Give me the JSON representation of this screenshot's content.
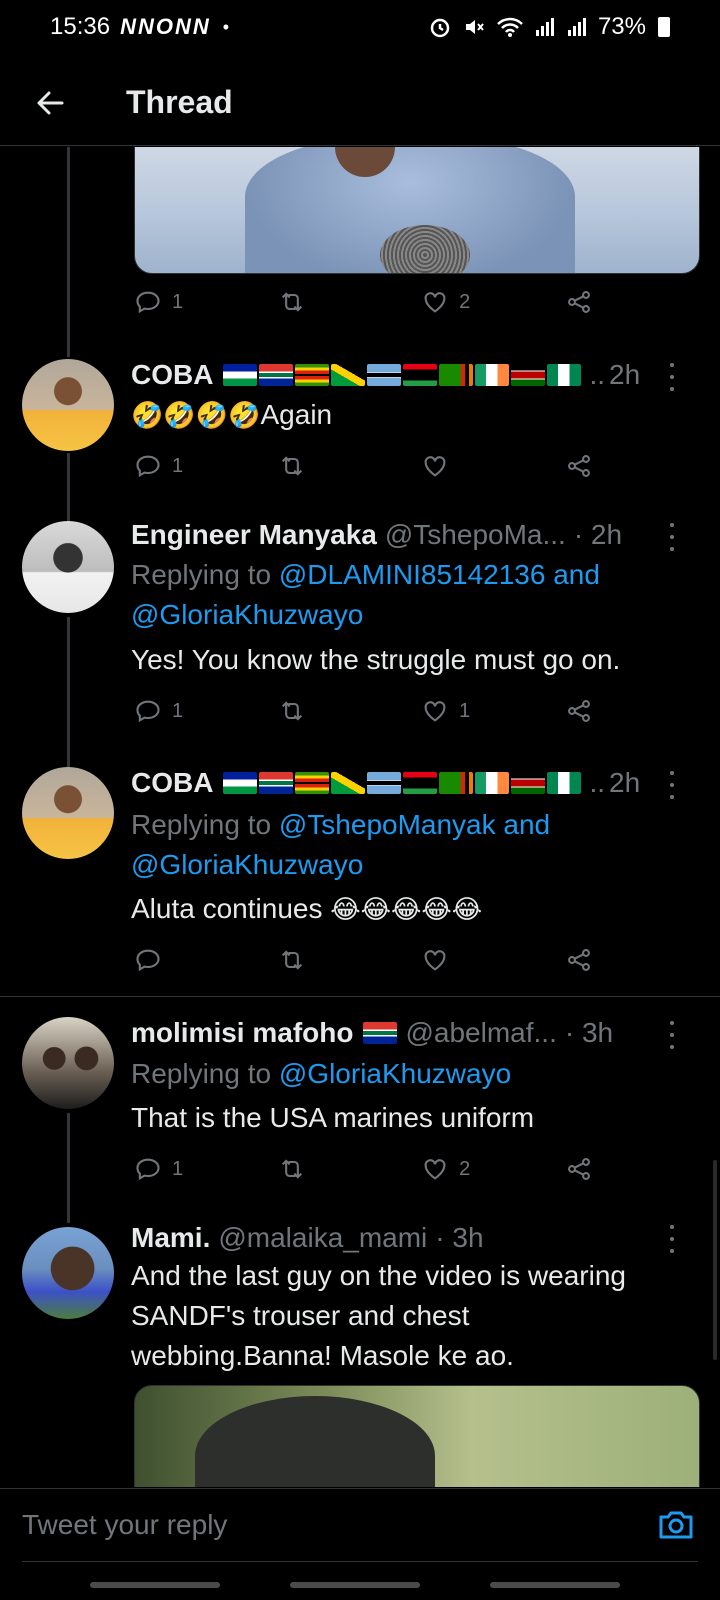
{
  "status_bar": {
    "time": "15:36",
    "notification_icons": "NNONN",
    "dot": "•",
    "battery": "73%",
    "icons": [
      "alarm-icon",
      "mute-icon",
      "wifi-icon",
      "signal-icon",
      "signal-icon",
      "battery-icon"
    ]
  },
  "header": {
    "title": "Thread",
    "back_icon": "arrow-left-icon"
  },
  "tweets": [
    {
      "actions": {
        "reply": "1",
        "retweet": "",
        "like": "2"
      }
    },
    {
      "name": "COBA",
      "flags_suffix": "..",
      "time": "2h",
      "text_emoji": "🤣🤣🤣🤣",
      "text": "Again",
      "actions": {
        "reply": "1",
        "retweet": "",
        "like": ""
      }
    },
    {
      "name": "Engineer Manyaka",
      "handle": "@TshepoMa...",
      "time": "· 2h",
      "replying_prefix": "Replying to ",
      "replying_link1": "@DLAMINI85142136 and",
      "replying_link2": "@GloriaKhuzwayo",
      "text": "Yes! You know the struggle must go on.",
      "actions": {
        "reply": "1",
        "retweet": "",
        "like": "1"
      }
    },
    {
      "name": "COBA",
      "flags_suffix": "..",
      "time": "2h",
      "replying_prefix": "Replying to ",
      "replying_link1": "@TshepoManyak and",
      "replying_link2": "@GloriaKhuzwayo",
      "text": "Aluta continues",
      "text_emoji": "😂😂😂😂😂",
      "actions": {
        "reply": "",
        "retweet": "",
        "like": ""
      }
    },
    {
      "name": "molimisi  mafoho",
      "handle": "@abelmaf...",
      "time": "· 3h",
      "replying_prefix": "Replying to ",
      "replying_link1": "@GloriaKhuzwayo",
      "text": "That is the USA marines  uniform",
      "actions": {
        "reply": "1",
        "retweet": "",
        "like": "2"
      }
    },
    {
      "name": "Mami.",
      "handle": "@malaika_mami",
      "time": "· 3h",
      "text_line1": "And the last guy on the video is wearing",
      "text_line2": "SANDF's trouser and chest",
      "text_line3": "webbing.Banna! Masole ke ao."
    }
  ],
  "reply_bar": {
    "placeholder": "Tweet your reply",
    "camera_icon": "camera-icon"
  },
  "colors": {
    "background": "#000000",
    "text_primary": "#e7e9ea",
    "text_secondary": "#71767b",
    "link": "#1d9bf0",
    "divider": "#2f3336"
  }
}
